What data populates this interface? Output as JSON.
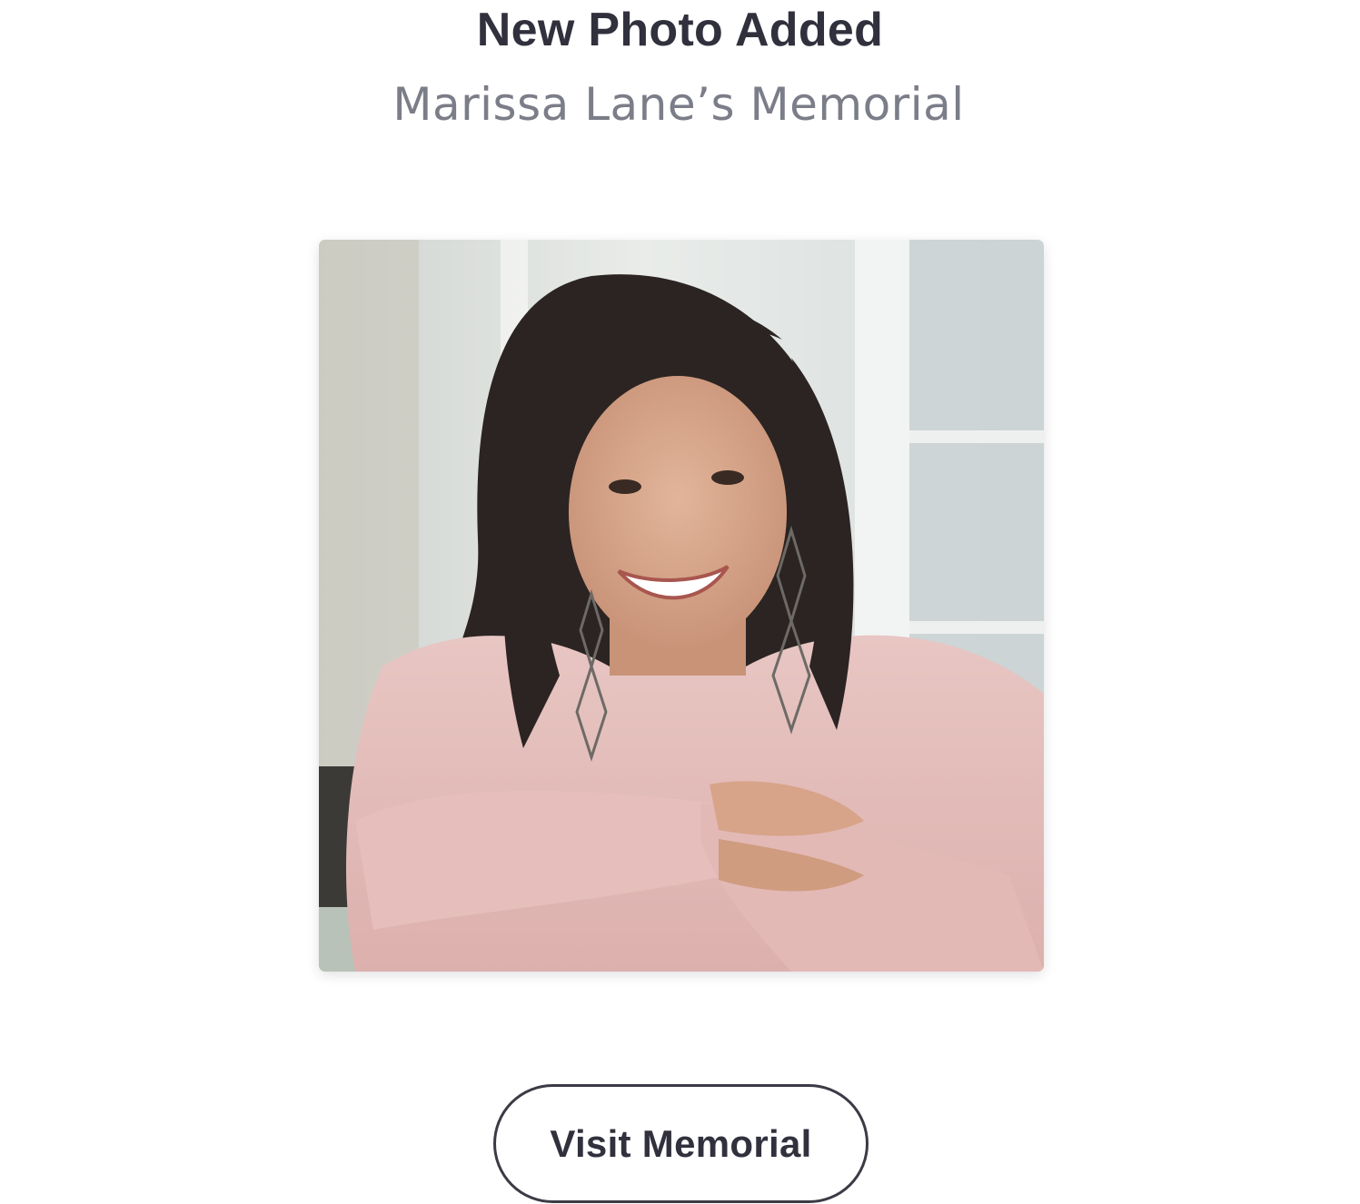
{
  "notification": {
    "title": "New Photo Added",
    "subtitle": "Marissa Lane’s Memorial"
  },
  "photo": {
    "icon": "portrait-photo"
  },
  "actions": {
    "visit_label": "Visit Memorial"
  },
  "colors": {
    "title": "#30313d",
    "subtitle": "#7b7d88",
    "button_text": "#30313d",
    "button_border": "#3a3b45"
  }
}
